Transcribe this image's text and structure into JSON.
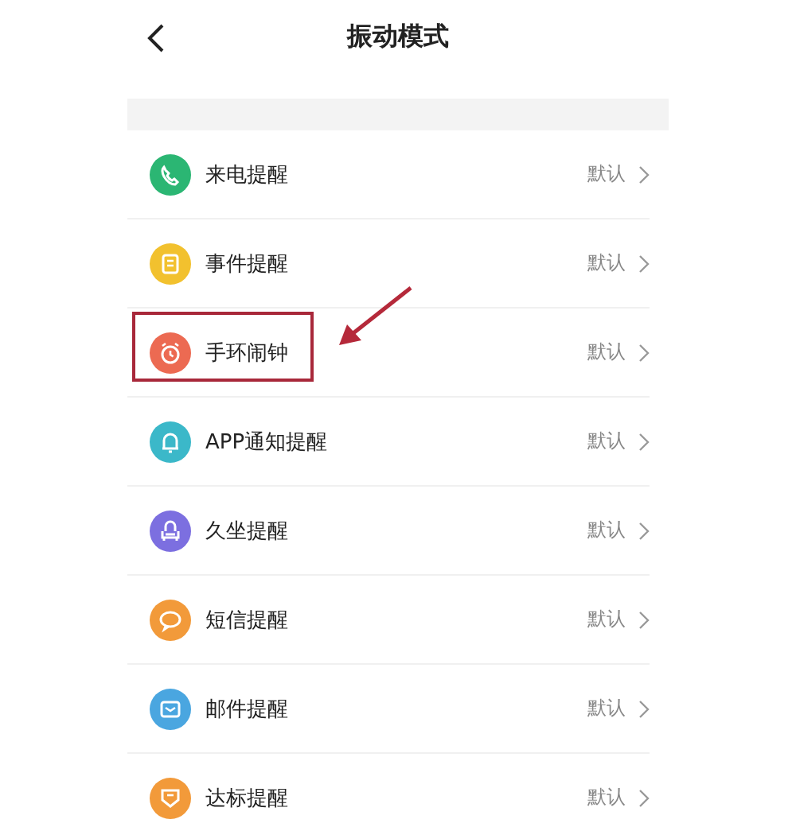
{
  "header": {
    "title": "振动模式"
  },
  "items": [
    {
      "label": "来电提醒",
      "value": "默认",
      "color": "#2bb673",
      "highlighted": false
    },
    {
      "label": "事件提醒",
      "value": "默认",
      "color": "#f2c12e",
      "highlighted": false
    },
    {
      "label": "手环闹钟",
      "value": "默认",
      "color": "#ec6a52",
      "highlighted": true
    },
    {
      "label": "APP通知提醒",
      "value": "默认",
      "color": "#3bb8c9",
      "highlighted": false
    },
    {
      "label": "久坐提醒",
      "value": "默认",
      "color": "#7c6fe0",
      "highlighted": false
    },
    {
      "label": "短信提醒",
      "value": "默认",
      "color": "#f29a3a",
      "highlighted": false
    },
    {
      "label": "邮件提醒",
      "value": "默认",
      "color": "#4aa6e0",
      "highlighted": false
    },
    {
      "label": "达标提醒",
      "value": "默认",
      "color": "#f29a3a",
      "highlighted": false
    }
  ]
}
